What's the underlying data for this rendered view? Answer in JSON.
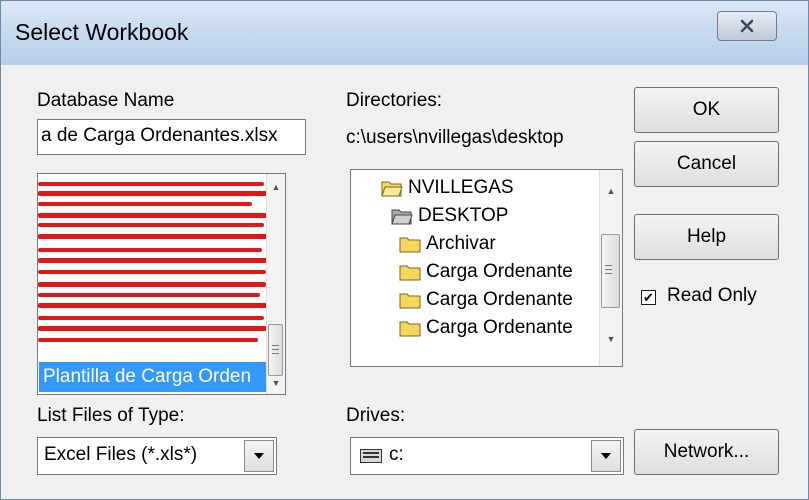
{
  "window": {
    "title": "Select Workbook"
  },
  "database": {
    "label": "Database Name",
    "value": "a de Carga Ordenantes.xlsx",
    "selected_item": "Plantilla de Carga Orden"
  },
  "directories": {
    "label": "Directories:",
    "path": "c:\\users\\nvillegas\\desktop",
    "items": [
      {
        "label": "NVILLEGAS",
        "icon": "open-folder-icon"
      },
      {
        "label": "DESKTOP",
        "icon": "open-folder-icon"
      },
      {
        "label": "Archivar",
        "icon": "folder-icon"
      },
      {
        "label": "Carga Ordenante",
        "icon": "folder-icon"
      },
      {
        "label": "Carga Ordenante",
        "icon": "folder-icon"
      },
      {
        "label": "Carga Ordenante",
        "icon": "folder-icon"
      }
    ]
  },
  "buttons": {
    "ok": "OK",
    "cancel": "Cancel",
    "help": "Help",
    "network": "Network..."
  },
  "read_only": {
    "label": "Read Only",
    "checked": true,
    "mark": "✔"
  },
  "file_type": {
    "label": "List Files of Type:",
    "value": "Excel Files (*.xls*)"
  },
  "drives": {
    "label": "Drives:",
    "value": "c:"
  },
  "colors": {
    "selection": "#3399ff",
    "redaction": "#e01818",
    "folder": "#f5d75a"
  }
}
